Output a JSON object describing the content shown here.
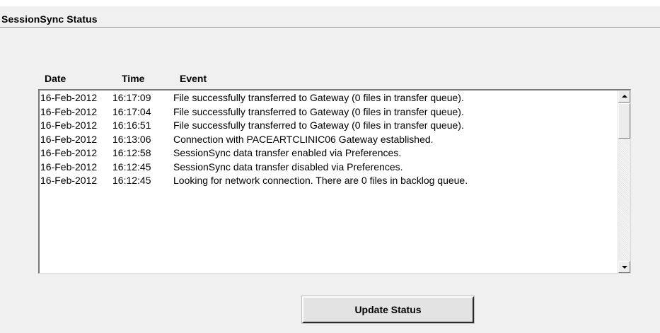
{
  "panel": {
    "title": "SessionSync Status"
  },
  "log": {
    "columns": {
      "date": "Date",
      "time": "Time",
      "event": "Event"
    },
    "rows": [
      {
        "date": "16-Feb-2012",
        "time": "16:17:09",
        "event": "File successfully transferred to Gateway (0 files in transfer queue)."
      },
      {
        "date": "16-Feb-2012",
        "time": "16:17:04",
        "event": "File successfully transferred to Gateway (0 files in transfer queue)."
      },
      {
        "date": "16-Feb-2012",
        "time": "16:16:51",
        "event": "File successfully transferred to Gateway (0 files in transfer queue)."
      },
      {
        "date": "16-Feb-2012",
        "time": "16:13:06",
        "event": "Connection with PACEARTCLINIC06 Gateway established."
      },
      {
        "date": "16-Feb-2012",
        "time": "16:12:58",
        "event": "SessionSync data transfer enabled via Preferences."
      },
      {
        "date": "16-Feb-2012",
        "time": "16:12:45",
        "event": "SessionSync data transfer disabled via Preferences."
      },
      {
        "date": "16-Feb-2012",
        "time": "16:12:45",
        "event": "Looking for network connection. There are 0 files in backlog queue."
      }
    ]
  },
  "actions": {
    "update_label": "Update Status"
  },
  "icons": {
    "scroll_up": "triangle-up-icon",
    "scroll_down": "triangle-down-icon"
  }
}
